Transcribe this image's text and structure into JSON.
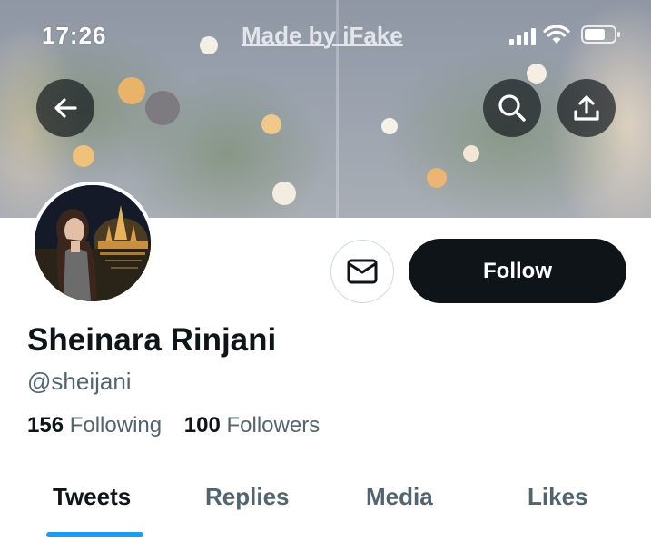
{
  "status_bar": {
    "time": "17:26",
    "watermark": "Made by iFake"
  },
  "header": {
    "back_icon": "arrow-left-icon",
    "search_icon": "search-icon",
    "share_icon": "share-upload-icon"
  },
  "profile": {
    "display_name": "Sheinara Rinjani",
    "handle": "@sheijani",
    "following_count": "156",
    "following_label": "Following",
    "followers_count": "100",
    "followers_label": "Followers",
    "follow_button_label": "Follow",
    "message_icon": "mail-icon"
  },
  "tabs": [
    {
      "label": "Tweets",
      "active": true
    },
    {
      "label": "Replies",
      "active": false
    },
    {
      "label": "Media",
      "active": false
    },
    {
      "label": "Likes",
      "active": false
    }
  ],
  "colors": {
    "accent": "#1d9bf0",
    "primary_text": "#0f1419",
    "secondary_text": "#536471",
    "follow_button": "#0f1419"
  }
}
